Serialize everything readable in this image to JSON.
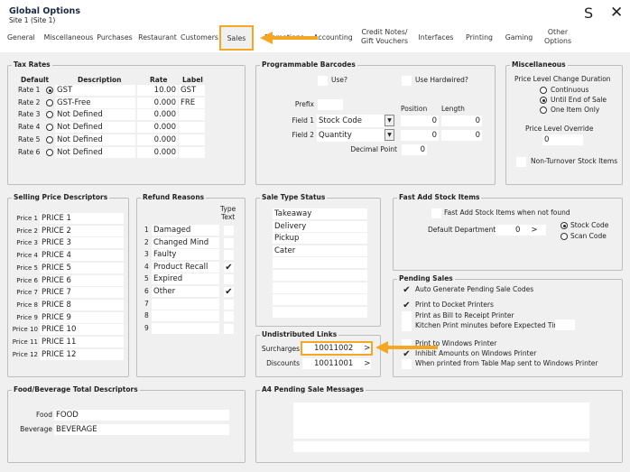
{
  "window": {
    "title": "Global Options",
    "subtitle": "Site 1  (Site 1)",
    "s_label": "S",
    "close_icon": "close-icon"
  },
  "tabs": [
    "General",
    "Miscellaneous",
    "Purchases",
    "Restaurant",
    "Customers",
    "Sales",
    "Promotions",
    "Accounting",
    "Credit Notes/\nGift Vouchers",
    "Interfaces",
    "Printing",
    "Gaming",
    "Other\nOptions"
  ],
  "active_tab": "Sales",
  "accent": "#f5a623",
  "tax_rates": {
    "title": "Tax Rates",
    "headers": {
      "default": "Default",
      "description": "Description",
      "rate": "Rate",
      "label": "Label"
    },
    "rows": [
      {
        "name": "Rate 1",
        "default": true,
        "description": "GST",
        "rate": "10.00",
        "label": "GST"
      },
      {
        "name": "Rate 2",
        "default": false,
        "description": "GST-Free",
        "rate": "0.000",
        "label": "FRE"
      },
      {
        "name": "Rate 3",
        "default": false,
        "description": "Not Defined",
        "rate": "0.000",
        "label": ""
      },
      {
        "name": "Rate 4",
        "default": false,
        "description": "Not Defined",
        "rate": "0.000",
        "label": ""
      },
      {
        "name": "Rate 5",
        "default": false,
        "description": "Not Defined",
        "rate": "0.000",
        "label": ""
      },
      {
        "name": "Rate 6",
        "default": false,
        "description": "Not Defined",
        "rate": "0.000",
        "label": ""
      }
    ]
  },
  "barcodes": {
    "title": "Programmable Barcodes",
    "use": "Use?",
    "use_hardwired": "Use Hardwired?",
    "prefix": "Prefix",
    "position": "Position",
    "length": "Length",
    "field1": {
      "label": "Field 1",
      "value": "Stock Code",
      "position": "0",
      "length": "0"
    },
    "field2": {
      "label": "Field 2",
      "value": "Quantity",
      "position": "0",
      "length": "0"
    },
    "decimal_point": "Decimal Point",
    "decimal_value": "0"
  },
  "misc": {
    "title": "Miscellaneous",
    "duration_label": "Price Level Change Duration",
    "options": [
      "Continuous",
      "Until End of Sale",
      "One Item Only"
    ],
    "selected": "Until End of Sale",
    "override_label": "Price Level Override",
    "override_value": "0",
    "non_turnover": "Non-Turnover Stock Items"
  },
  "selling_price": {
    "title": "Selling Price Descriptors",
    "rows": [
      {
        "label": "Price 1",
        "value": "PRICE 1"
      },
      {
        "label": "Price 2",
        "value": "PRICE 2"
      },
      {
        "label": "Price 3",
        "value": "PRICE 3"
      },
      {
        "label": "Price 4",
        "value": "PRICE 4"
      },
      {
        "label": "Price 5",
        "value": "PRICE 5"
      },
      {
        "label": "Price 6",
        "value": "PRICE 6"
      },
      {
        "label": "Price 7",
        "value": "PRICE 7"
      },
      {
        "label": "Price 8",
        "value": "PRICE 8"
      },
      {
        "label": "Price 9",
        "value": "PRICE 9"
      },
      {
        "label": "Price 10",
        "value": "PRICE 10"
      },
      {
        "label": "Price 11",
        "value": "PRICE 11"
      },
      {
        "label": "Price 12",
        "value": "PRICE 12"
      }
    ]
  },
  "refund": {
    "title": "Refund Reasons",
    "type_text": "Type\nText",
    "rows": [
      {
        "n": "1",
        "value": "Damaged",
        "type": false
      },
      {
        "n": "2",
        "value": "Changed Mind",
        "type": false
      },
      {
        "n": "3",
        "value": "Faulty",
        "type": false
      },
      {
        "n": "4",
        "value": "Product Recall",
        "type": true
      },
      {
        "n": "5",
        "value": "Expired",
        "type": false
      },
      {
        "n": "6",
        "value": "Other",
        "type": true
      },
      {
        "n": "7",
        "value": "",
        "type": false
      },
      {
        "n": "8",
        "value": "",
        "type": false
      },
      {
        "n": "9",
        "value": "",
        "type": false
      }
    ]
  },
  "sale_type": {
    "title": "Sale Type Status",
    "rows": [
      "Takeaway",
      "Delivery",
      "Pickup",
      "Cater",
      "",
      "",
      "",
      "",
      ""
    ]
  },
  "undistributed": {
    "title": "Undistributed Links",
    "surcharges_label": "Surcharges",
    "surcharges": "10011002",
    "discounts_label": "Discounts",
    "discounts": "10011001",
    "go": ">"
  },
  "fast_add": {
    "title": "Fast Add Stock Items",
    "enable": "Fast Add Stock Items when not found",
    "dept_label": "Default Department",
    "dept_value": "0",
    "go": ">",
    "options": [
      "Stock Code",
      "Scan Code"
    ],
    "selected": "Stock Code"
  },
  "pending": {
    "title": "Pending Sales",
    "items": [
      {
        "label": "Auto Generate Pending Sale Codes",
        "checked": true
      },
      {
        "label": "Print to Docket Printers",
        "checked": true
      },
      {
        "label": "Print as Bill to Receipt Printer",
        "checked": false
      },
      {
        "label": "Kitchen Print minutes before Expected Time",
        "checked": false
      },
      {
        "label": "Print to Windows Printer",
        "checked": false
      },
      {
        "label": "Inhibit Amounts on Windows Printer",
        "checked": true
      },
      {
        "label": "When printed from Table Map sent to Windows Printer",
        "checked": false
      }
    ]
  },
  "food_bev": {
    "title": "Food/Beverage Total Descriptors",
    "food_label": "Food",
    "food": "FOOD",
    "bev_label": "Beverage",
    "bev": "BEVERAGE"
  },
  "a4": {
    "title": "A4 Pending Sale Messages"
  }
}
